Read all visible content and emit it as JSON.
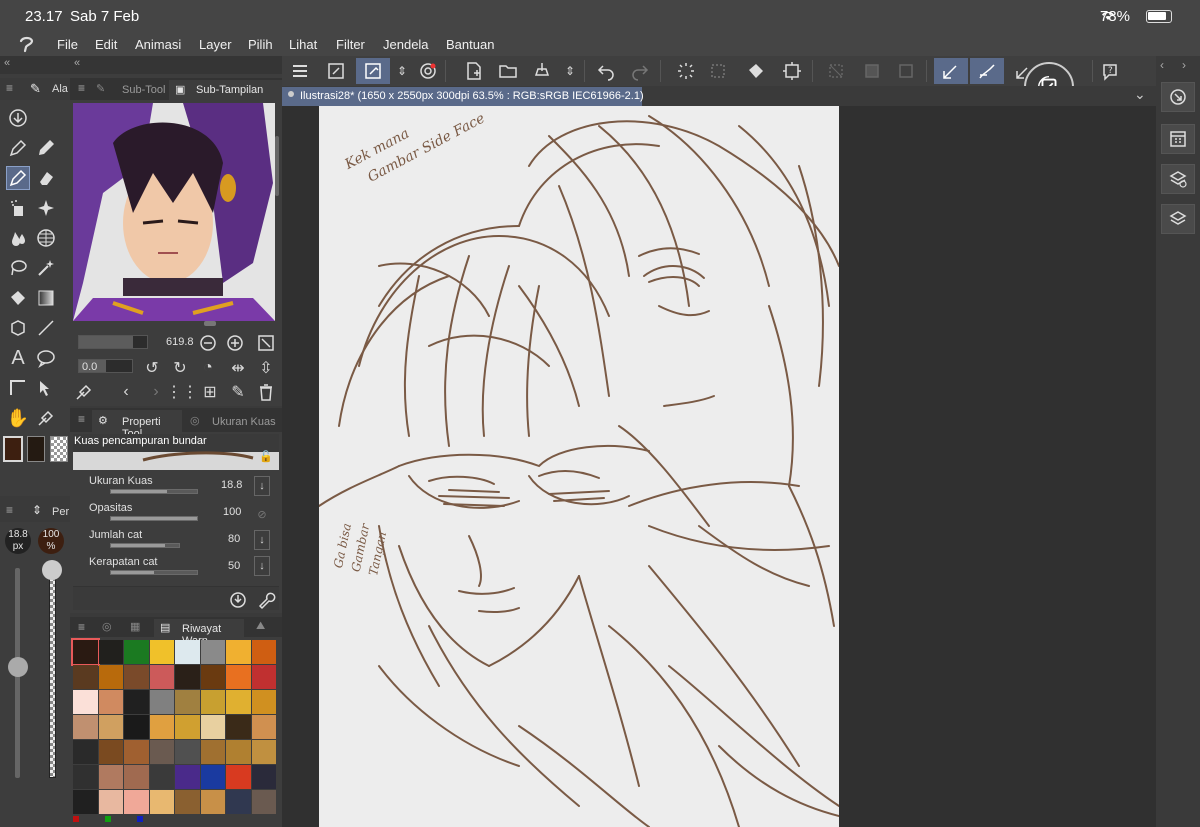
{
  "status": {
    "time": "23.17",
    "date": "Sab 7 Feb",
    "battery": "78%"
  },
  "menu": [
    "File",
    "Edit",
    "Animasi",
    "Layer",
    "Pilih",
    "Lihat",
    "Filter",
    "Jendela",
    "Bantuan"
  ],
  "tool_panel": {
    "tab": "Ala"
  },
  "subview": {
    "tab1": "Sub-Tool",
    "tab2": "Sub-Tampilan",
    "zoom": "619.8",
    "rotation": "0.0"
  },
  "tool_property": {
    "tab1": "Properti Tool",
    "tab2": "Ukuran Kuas",
    "brush_name": "Kuas pencampuran bundar",
    "props": [
      {
        "label": "Ukuran Kuas",
        "value": "18.8",
        "level": 0.65
      },
      {
        "label": "Opasitas",
        "value": "100",
        "level": 1.0
      },
      {
        "label": "Jumlah cat",
        "value": "80",
        "level": 0.8
      },
      {
        "label": "Kerapatan cat",
        "value": "50",
        "level": 0.5
      }
    ]
  },
  "brush_quick": {
    "tab": "Per",
    "size": "18.8",
    "size_unit": "px",
    "opacity": "100",
    "opacity_unit": "%"
  },
  "color_panel": {
    "tab": "Riwayat Warn"
  },
  "swatches": [
    "#2a1a12",
    "#21201d",
    "#1b7a21",
    "#f0c12a",
    "#dde9ee",
    "#8a8a8a",
    "#f0b030",
    "#cf5e12",
    "#5a3a20",
    "#b86a0c",
    "#7a4a2a",
    "#cc5a5a",
    "#2a2018",
    "#6a3a10",
    "#e87020",
    "#c03030",
    "#fbe0d8",
    "#d08a60",
    "#202020",
    "#808080",
    "#a08040",
    "#c8a030",
    "#e0b030",
    "#d09020",
    "#c09070",
    "#d0a060",
    "#1a1a1a",
    "#e0a040",
    "#d0a030",
    "#e8d0a0",
    "#3a2a18",
    "#d09050",
    "#2a2a2a",
    "#7a4a20",
    "#a06030",
    "#6a5a50",
    "#505050",
    "#a07030",
    "#b08030",
    "#c09040",
    "#303030",
    "#b07a60",
    "#a06a50",
    "#3a3a3a",
    "#4a2a8a",
    "#1a3aa0",
    "#d83a20",
    "#2a2a3a",
    "#202020",
    "#e8b8a0",
    "#f0a898",
    "#e8b870",
    "#8a6030",
    "#c89048",
    "#303850",
    "#6a5a50"
  ],
  "document": {
    "title": "Ilustrasi28* (1650 x 2550px 300dpi 63.5% : RGB:sRGB IEC61966-2.1)"
  },
  "canvas_notes": {
    "note1_line1": "Kek mana",
    "note1_line2": "Gambar Side Face",
    "note2_line1": "Ga bisa",
    "note2_line2": "Gambar",
    "note2_line3": "Tangan"
  },
  "colors": {
    "ui_bg": "#3a3a3a",
    "panel": "#3d3d3d",
    "accent": "#5a6a8a",
    "canvas": "#ededed",
    "ink": "#7a5a45",
    "main_color": "#3d1f10",
    "sub_color": "#241a12"
  }
}
